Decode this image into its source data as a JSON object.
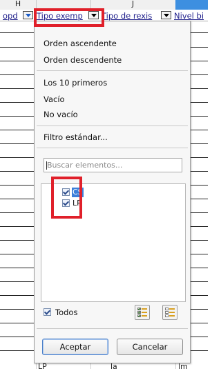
{
  "column_letters": [
    "H",
    "J"
  ],
  "header_cells": [
    "opd",
    "Tipo exemp",
    "Tipo de rexis",
    "Nivel bi"
  ],
  "bottom_cells": [
    "LP",
    "la",
    "lm"
  ],
  "popup": {
    "sort_items": [
      "Orden ascendente",
      "Orden descendente"
    ],
    "filter_items": [
      "Los 10 primeros",
      "Vacío",
      "No vacío"
    ],
    "standard_filter": "Filtro estándar...",
    "search_placeholder": "Buscar elementos...",
    "values": [
      {
        "label": "CS",
        "checked": true,
        "highlighted": true
      },
      {
        "label": "LP",
        "checked": true,
        "highlighted": false
      }
    ],
    "all_label": "Todos",
    "all_checked": true,
    "ok_label": "Aceptar",
    "cancel_label": "Cancelar"
  },
  "icons": {
    "select_all": "check-list-icon",
    "deselect_all": "uncheck-list-icon",
    "dropdown": "dropdown-arrow-icon"
  },
  "colors": {
    "highlight_box": "#e0202a",
    "selection": "#3d7fd9"
  }
}
